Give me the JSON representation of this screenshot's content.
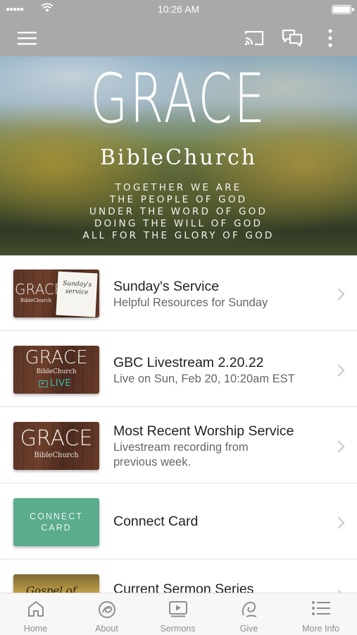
{
  "status_bar": {
    "time": "10:26 AM"
  },
  "toolbar": {
    "menu_icon": "hamburger-menu-icon",
    "cast_icon": "cast-icon",
    "chat_icon": "chat-bubbles-icon",
    "more_icon": "vertical-ellipsis-icon"
  },
  "hero": {
    "logo_title": "GRACE",
    "logo_subtitle": "BibleChurch",
    "tagline": [
      "TOGETHER WE ARE",
      "THE PEOPLE OF GOD",
      "UNDER THE WORD OF GOD",
      "DOING THE WILL OF GOD",
      "ALL FOR THE GLORY OF GOD"
    ]
  },
  "list": [
    {
      "title": "Sunday's Service",
      "subtitle": "Helpful Resources for Sunday",
      "thumb": {
        "logo": "GRACE",
        "logo_sub": "BibleChurch",
        "note": "Sunday's service"
      }
    },
    {
      "title": "GBC Livestream 2.20.22",
      "subtitle": "Live on Sun, Feb 20, 10:20am EST",
      "thumb": {
        "logo": "GRACE",
        "logo_sub": "BibleChurch",
        "badge": "LIVE"
      }
    },
    {
      "title": "Most Recent Worship Service",
      "subtitle_line1": "Livestream recording from",
      "subtitle_line2": "previous week.",
      "thumb": {
        "logo": "GRACE",
        "logo_sub": "BibleChurch"
      }
    },
    {
      "title": "Connect Card",
      "thumb": {
        "line1": "CONNECT",
        "line2": "CARD"
      }
    },
    {
      "title": "Current Sermon Series",
      "thumb": {
        "text": "Gospel of John"
      }
    }
  ],
  "tabs": [
    {
      "label": "Home",
      "icon": "home-icon"
    },
    {
      "label": "About",
      "icon": "about-swirl-icon"
    },
    {
      "label": "Sermons",
      "icon": "video-player-icon"
    },
    {
      "label": "Give",
      "icon": "give-swirl-icon"
    },
    {
      "label": "More Info",
      "icon": "list-icon"
    }
  ],
  "colors": {
    "toolbar": "#a9a9a9",
    "connect_card": "#5bab8d",
    "live_accent": "#3fb7a4"
  }
}
